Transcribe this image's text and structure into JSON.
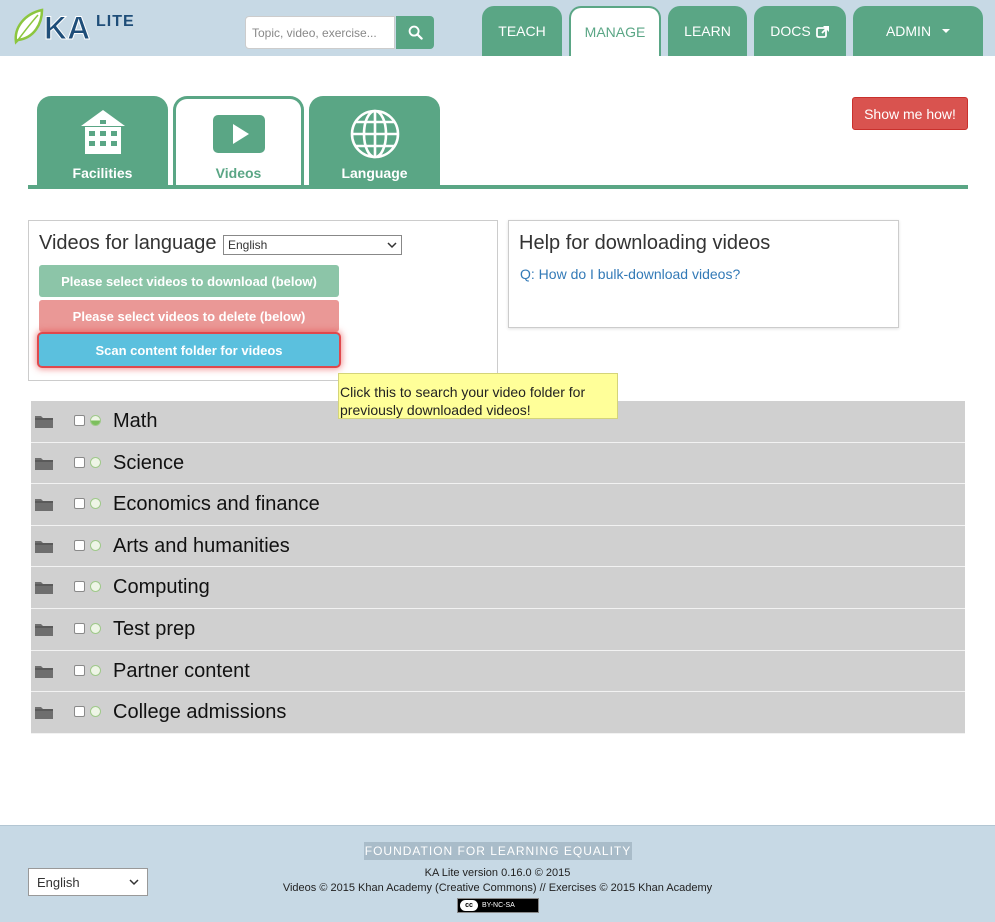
{
  "header": {
    "logo_text": "KA LITE",
    "search": {
      "placeholder": "Topic, video, exercise...",
      "value": ""
    },
    "nav": [
      {
        "label": "TEACH",
        "active": false
      },
      {
        "label": "MANAGE",
        "active": true
      },
      {
        "label": "LEARN",
        "active": false
      },
      {
        "label": "DOCS",
        "active": false,
        "icon": "external-link-icon"
      },
      {
        "label": "ADMIN",
        "active": false,
        "icon": "caret-down-icon"
      }
    ]
  },
  "tabs": [
    {
      "label": "Facilities",
      "icon": "building-icon",
      "active": false
    },
    {
      "label": "Videos",
      "icon": "video-play-icon",
      "active": true
    },
    {
      "label": "Language",
      "icon": "globe-icon",
      "active": false
    }
  ],
  "show_me_how": "Show me how!",
  "videos_panel": {
    "title": "Videos for language",
    "language_selected": "English",
    "download_button": "Please select videos to download (below)",
    "delete_button": "Please select videos to delete (below)",
    "scan_button": "Scan content folder for videos"
  },
  "help_panel": {
    "title": "Help for downloading videos",
    "link": "Q: How do I bulk-download videos?"
  },
  "tooltip": "Click this to search your video folder for previously downloaded videos!",
  "topics": [
    {
      "label": "Math",
      "status": "partial"
    },
    {
      "label": "Science",
      "status": "none"
    },
    {
      "label": "Economics and finance",
      "status": "none"
    },
    {
      "label": "Arts and humanities",
      "status": "none"
    },
    {
      "label": "Computing",
      "status": "none"
    },
    {
      "label": "Test prep",
      "status": "none"
    },
    {
      "label": "Partner content",
      "status": "none"
    },
    {
      "label": "College admissions",
      "status": "none"
    }
  ],
  "footer": {
    "organization": "FOUNDATION FOR LEARNING EQUALITY",
    "version": "KA Lite version 0.16.0 © 2015",
    "copyright": "Videos © 2015 Khan Academy (Creative Commons) // Exercises © 2015 Khan Academy",
    "license_badge": "BY-NC-SA",
    "language_selected": "English"
  },
  "colors": {
    "primary_green": "#5aa685",
    "header_bg": "#c7d9e5",
    "danger": "#d9534f",
    "info": "#5bc0de",
    "tooltip_bg": "#ffff99",
    "tree_row_bg": "#d0d0d0"
  }
}
